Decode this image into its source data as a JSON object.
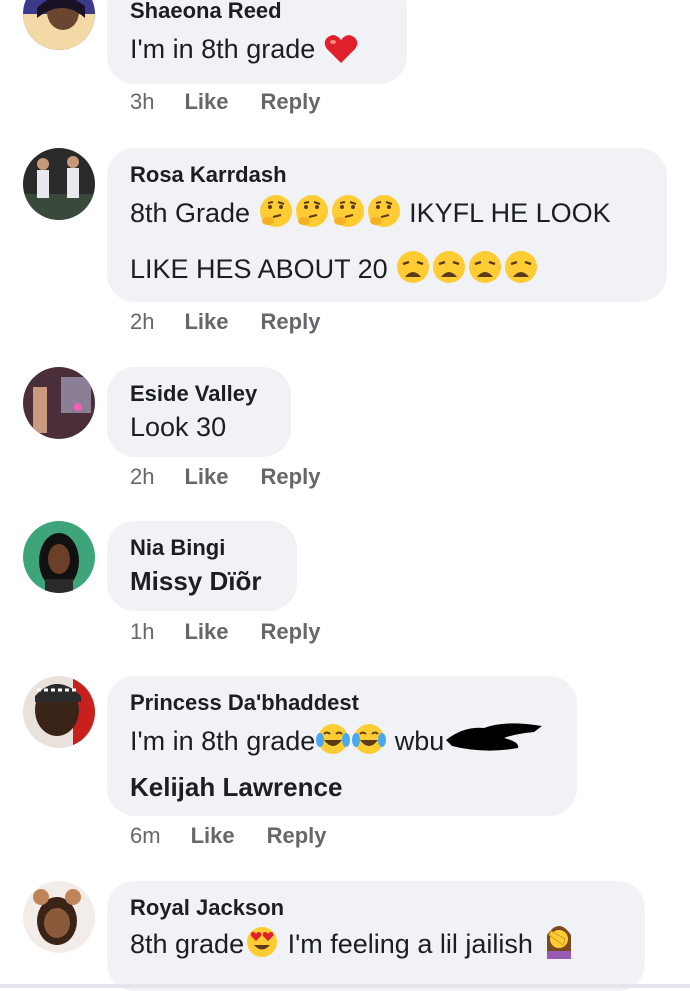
{
  "comments": [
    {
      "author": "Shaeona Reed",
      "text": "I'm in 8th grade",
      "time": "3h",
      "like": "Like",
      "reply": "Reply",
      "emojis": [
        "red-heart"
      ]
    },
    {
      "author": "Rosa Karrdash",
      "text_line1": "8th Grade",
      "text_line1_after": "IKYFL HE LOOK",
      "text_line2": "LIKE HES ABOUT 20",
      "time": "2h",
      "like": "Like",
      "reply": "Reply",
      "emojis": [
        "thinking-face",
        "thinking-face",
        "thinking-face",
        "thinking-face",
        "weary-face",
        "weary-face",
        "weary-face",
        "weary-face"
      ]
    },
    {
      "author": "Eside Valley",
      "text": "Look 30",
      "time": "2h",
      "like": "Like",
      "reply": "Reply"
    },
    {
      "author": "Nia Bingi",
      "text": "Missy Dïõr",
      "time": "1h",
      "like": "Like",
      "reply": "Reply"
    },
    {
      "author": "Princess Da'bhaddest",
      "text": "I'm in 8th grade",
      "text_after": "wbu",
      "tagged": "Kelijah Lawrence",
      "time": "6m",
      "like": "Like",
      "reply": "Reply",
      "emojis": [
        "tears-of-joy",
        "tears-of-joy"
      ]
    },
    {
      "author": "Royal Jackson",
      "text": "8th grade",
      "text_after": "I'm feeling a lil jailish",
      "time": "",
      "like": "",
      "reply": "",
      "emojis": [
        "heart-eyes",
        "woman-facepalming"
      ]
    }
  ],
  "colors": {
    "bubble": "#f0f2f5",
    "meta": "#65676b",
    "text": "#1c1e21"
  }
}
